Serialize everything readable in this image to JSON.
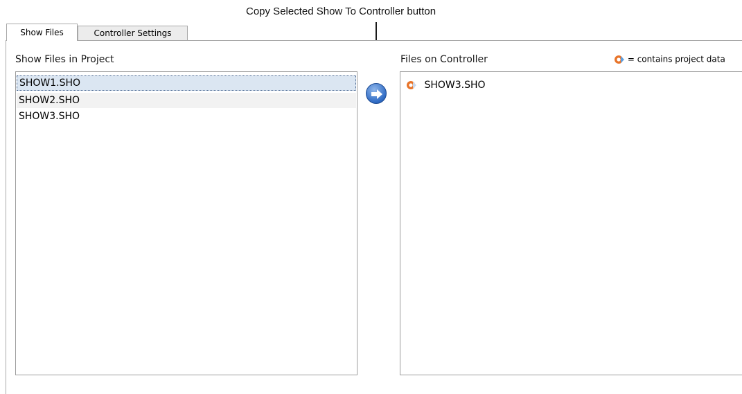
{
  "callout": {
    "text": "Copy Selected Show  To Controller button"
  },
  "tabs": [
    {
      "label": "Show Files",
      "active": true
    },
    {
      "label": "Controller Settings",
      "active": false
    }
  ],
  "left_panel": {
    "title": "Show Files in Project",
    "items": [
      {
        "label": "SHOW1.SHO",
        "selected": true
      },
      {
        "label": "SHOW2.SHO",
        "selected": false
      },
      {
        "label": "SHOW3.SHO",
        "selected": false
      }
    ]
  },
  "right_panel": {
    "title": "Files on Controller",
    "legend": "= contains project data",
    "legend_icon": "project-data-icon",
    "items": [
      {
        "label": "SHOW3.SHO",
        "icon": "project-data-icon"
      }
    ]
  },
  "copy_button": {
    "icon": "arrow-right-icon"
  },
  "colors": {
    "selection_bg": "#dbe6f2",
    "button_blue": "#2f6bc4",
    "icon_orange": "#e8742a"
  }
}
